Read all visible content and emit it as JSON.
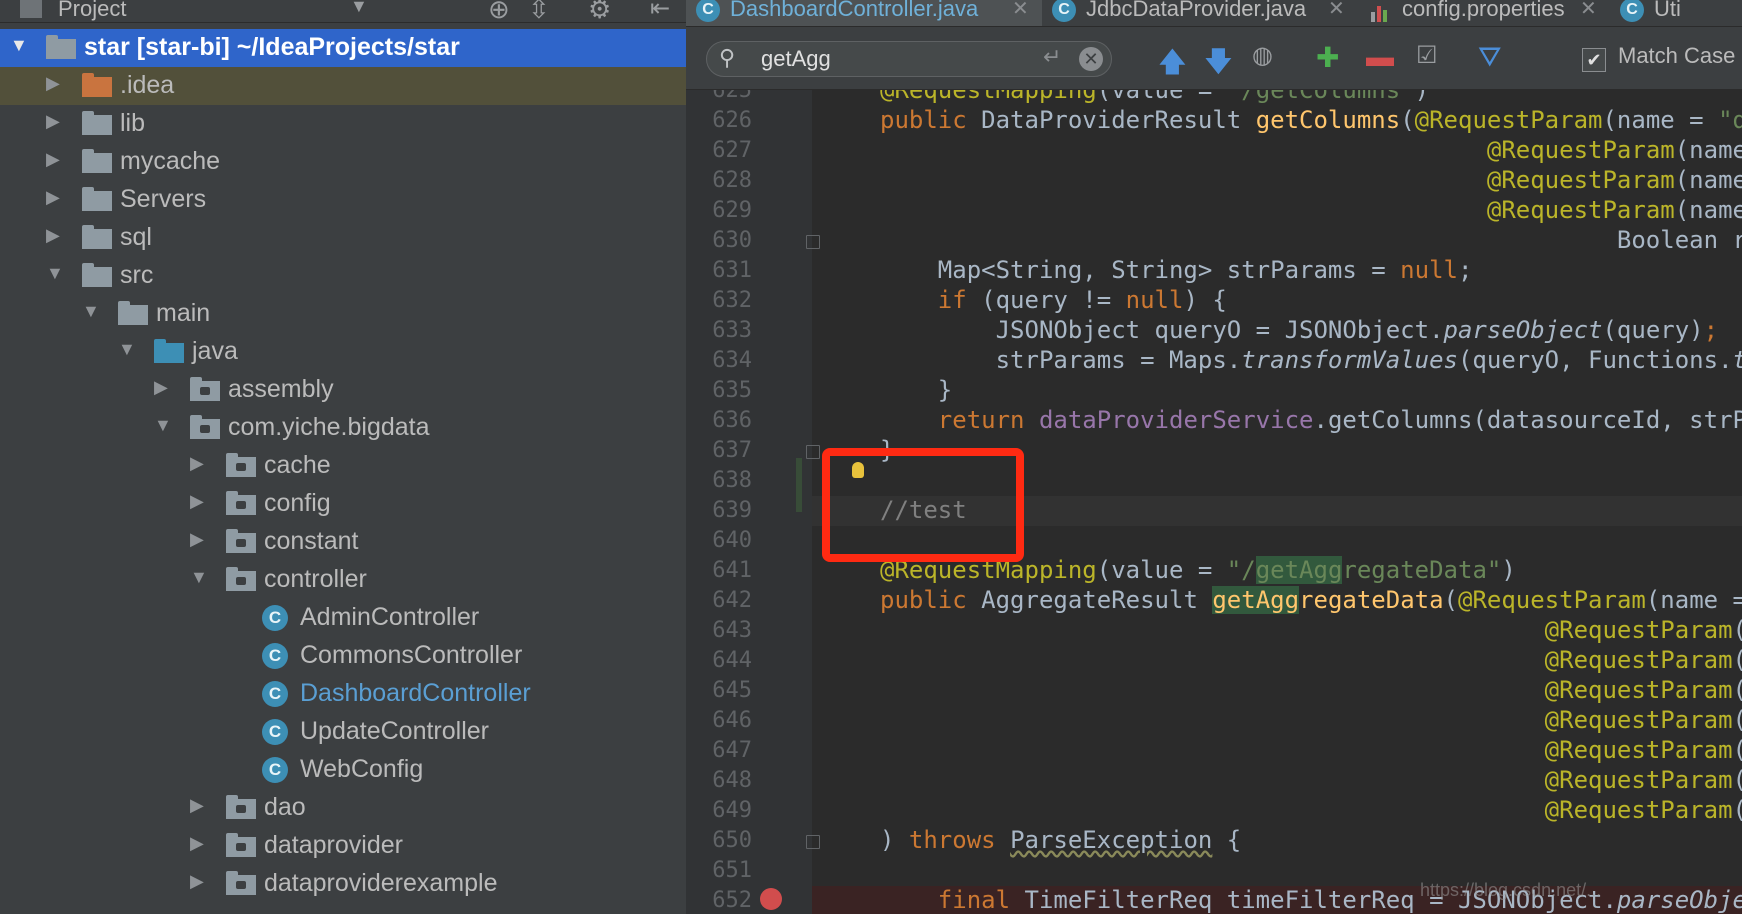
{
  "project_panel": {
    "title": "Project",
    "tree": [
      {
        "label": "star [star-bi]  ~/IdeaProjects/star",
        "type": "module",
        "depth": 0,
        "expanded": true,
        "selected": true
      },
      {
        "label": ".idea",
        "type": "folder-orange",
        "depth": 1,
        "expanded": false
      },
      {
        "label": "lib",
        "type": "folder",
        "depth": 1,
        "expanded": false
      },
      {
        "label": "mycache",
        "type": "folder",
        "depth": 1,
        "expanded": false
      },
      {
        "label": "Servers",
        "type": "folder",
        "depth": 1,
        "expanded": false
      },
      {
        "label": "sql",
        "type": "folder",
        "depth": 1,
        "expanded": false
      },
      {
        "label": "src",
        "type": "folder",
        "depth": 1,
        "expanded": true
      },
      {
        "label": "main",
        "type": "folder",
        "depth": 2,
        "expanded": true
      },
      {
        "label": "java",
        "type": "folder-blue",
        "depth": 3,
        "expanded": true
      },
      {
        "label": "assembly",
        "type": "package",
        "depth": 4,
        "expanded": false
      },
      {
        "label": "com.yiche.bigdata",
        "type": "package",
        "depth": 4,
        "expanded": true
      },
      {
        "label": "cache",
        "type": "package",
        "depth": 5,
        "expanded": false
      },
      {
        "label": "config",
        "type": "package",
        "depth": 5,
        "expanded": false
      },
      {
        "label": "constant",
        "type": "package",
        "depth": 5,
        "expanded": false
      },
      {
        "label": "controller",
        "type": "package",
        "depth": 5,
        "expanded": true
      },
      {
        "label": "AdminController",
        "type": "class",
        "depth": 6
      },
      {
        "label": "CommonsController",
        "type": "class",
        "depth": 6
      },
      {
        "label": "DashboardController",
        "type": "class",
        "depth": 6,
        "active": true
      },
      {
        "label": "UpdateController",
        "type": "class",
        "depth": 6
      },
      {
        "label": "WebConfig",
        "type": "class",
        "depth": 6
      },
      {
        "label": "dao",
        "type": "package",
        "depth": 5,
        "expanded": false
      },
      {
        "label": "dataprovider",
        "type": "package",
        "depth": 5,
        "expanded": false
      },
      {
        "label": "dataproviderexample",
        "type": "package",
        "depth": 5,
        "expanded": false
      }
    ]
  },
  "tabs": [
    {
      "label": "DashboardController.java",
      "icon": "class-icon",
      "active": true
    },
    {
      "label": "JdbcDataProvider.java",
      "icon": "class-icon",
      "active": false
    },
    {
      "label": "config.properties",
      "icon": "properties-icon",
      "active": false
    },
    {
      "label": "Uti",
      "icon": "class-icon",
      "active": false
    }
  ],
  "search": {
    "query": "getAgg",
    "match_case_label": "Match Case",
    "match_case_checked": true
  },
  "editor": {
    "lines": [
      {
        "n": "625",
        "html": "<span class=\"an\">@RequestMapping</span>(value = <span class=\"st\">\"/getColumns\"</span>)"
      },
      {
        "n": "626",
        "html": "<span class=\"kw\">public</span> DataProviderResult <span class=\"fn\">getColumns</span>(<span class=\"an\">@RequestParam</span>(name = <span class=\"st\">\"dat</span>"
      },
      {
        "n": "627",
        "html": "                                          <span class=\"an\">@RequestParam</span>(name = <span class=\"st\">\"que</span>"
      },
      {
        "n": "628",
        "html": "                                          <span class=\"an\">@RequestParam</span>(name = <span class=\"st\">\"dat</span>"
      },
      {
        "n": "629",
        "html": "                                          <span class=\"an\">@RequestParam</span>(name = <span class=\"st\">\"rel</span>"
      },
      {
        "n": "630",
        "html": "                                                   Boolean reload) {"
      },
      {
        "n": "631",
        "html": "    Map&lt;String, String&gt; strParams = <span class=\"kw\">null</span>;"
      },
      {
        "n": "632",
        "html": "    <span class=\"kw\">if</span> (query != <span class=\"kw\">null</span>) {"
      },
      {
        "n": "633",
        "html": "        JSONObject queryO = JSONObject.<span class=\"it\">parseObject</span>(query)<span class=\"kw\">;</span>"
      },
      {
        "n": "634",
        "html": "        strParams = Maps.<span class=\"it\">transformValues</span>(queryO, Functions.<span class=\"it\">toS</span>"
      },
      {
        "n": "635",
        "html": "    }"
      },
      {
        "n": "636",
        "html": "    <span class=\"kw\">return</span> <span class=\"pu\">dataProviderService</span>.getColumns(datasourceId, strPar"
      },
      {
        "n": "637",
        "html": "}"
      },
      {
        "n": "638",
        "html": ""
      },
      {
        "n": "639",
        "html": "<span class=\"cm\">//test</span>"
      },
      {
        "n": "640",
        "html": ""
      },
      {
        "n": "641",
        "html": "<span class=\"an\">@RequestMapping</span>(value = <span class=\"st\">\"/<span class=\"hit\">getAgg</span>regateData\"</span>)"
      },
      {
        "n": "642",
        "html": "<span class=\"kw\">public</span> AggregateResult <span class=\"fn\"><span class=\"hit\">getAgg</span>regateData</span>(<span class=\"an\">@RequestParam</span>(name = <span class=\"st\">\"</span>"
      },
      {
        "n": "643",
        "html": "                                              <span class=\"an\">@RequestParam</span>(name = <span class=\"st\">\"</span>"
      },
      {
        "n": "644",
        "html": "                                              <span class=\"an\">@RequestParam</span>(name = <span class=\"st\">\"</span>"
      },
      {
        "n": "645",
        "html": "                                              <span class=\"an\">@RequestParam</span>(name = <span class=\"st\">\"</span>"
      },
      {
        "n": "646",
        "html": "                                              <span class=\"an\">@RequestParam</span>(name = <span class=\"st\">\"</span>"
      },
      {
        "n": "647",
        "html": "                                              <span class=\"an\">@RequestParam</span>(name = <span class=\"st\">\"</span>"
      },
      {
        "n": "648",
        "html": "                                              <span class=\"an\">@RequestParam</span>(name = <span class=\"st\">\"</span>"
      },
      {
        "n": "649",
        "html": "                                              <span class=\"an\">@RequestParam</span>(name = <span class=\"st\">\"</span>"
      },
      {
        "n": "650",
        "html": ") <span class=\"kw\">throws</span> <span class=\"ul\">ParseException</span> {"
      },
      {
        "n": "651",
        "html": ""
      },
      {
        "n": "652",
        "html": "    <span class=\"kw\">final</span> TimeFilterReq timeFilterReq = JSONObject.<span class=\"it\">parseObject</span>"
      }
    ]
  },
  "watermark": "https://blog.csdn.net/...",
  "colors": {
    "selection": "#2f65ca",
    "highlight_box": "#ff2a12",
    "breakpoint": "#d14d4d"
  }
}
